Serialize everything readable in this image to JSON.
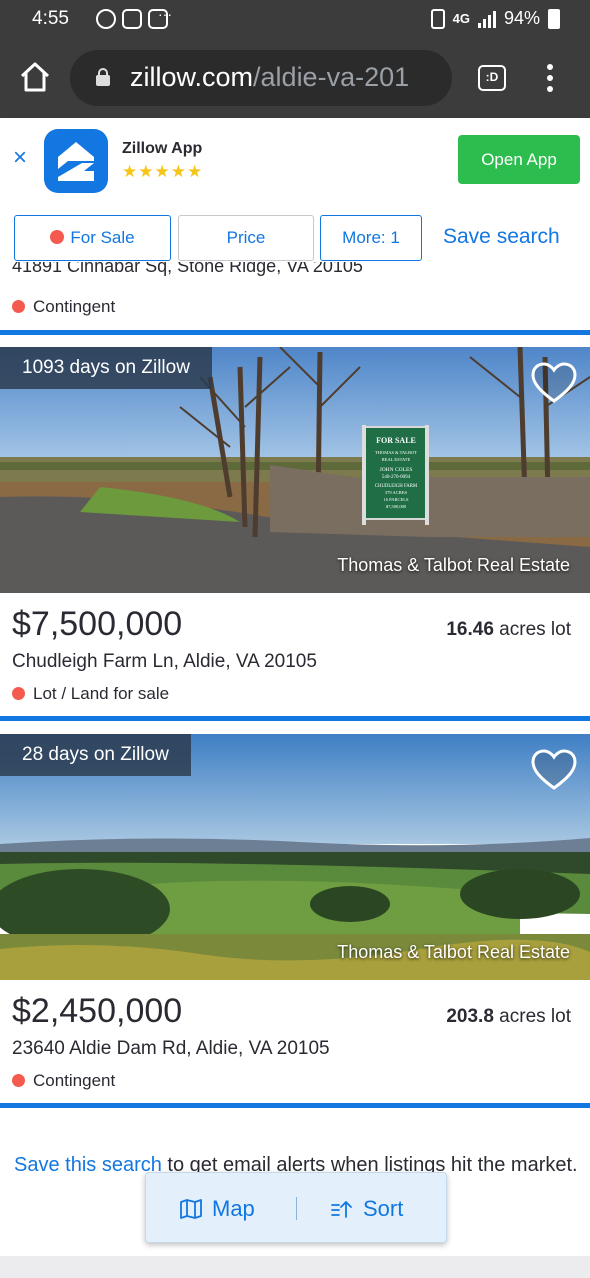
{
  "status_bar": {
    "time": "4:55",
    "dots": "···",
    "network": "4G",
    "battery": "94%"
  },
  "browser": {
    "url_host": "zillow.com",
    "url_path": "/aldie-va-201",
    "tabs_label": ":D"
  },
  "app_banner": {
    "close": "×",
    "app_name": "Zillow App",
    "stars": "★★★★★",
    "open_label": "Open App"
  },
  "filters": {
    "for_sale": "For Sale",
    "price": "Price",
    "more": "More: 1",
    "save_search": "Save search"
  },
  "partial_listing": {
    "address": "41891 Cinnabar Sq, Stone Ridge, VA 20105",
    "status": "Contingent"
  },
  "listings": [
    {
      "days": "1093 days on Zillow",
      "credit": "Thomas & Talbot Real Estate",
      "price": "$7,500,000",
      "lot_value": "16.46",
      "lot_unit": " acres lot",
      "address": "Chudleigh Farm Ln, Aldie, VA 20105",
      "status": "Lot / Land for sale",
      "sign": {
        "l1": "FOR SALE",
        "l2": "THOMAS & TALBOT",
        "l3": "REAL ESTATE",
        "l4": "JOHN COLES",
        "l5": "540-270-0094",
        "l6": "CHUDLEIGH FARM",
        "l7": "379 ACRES",
        "l8": "16 PARCELS",
        "l9": "$7,500,000"
      }
    },
    {
      "days": "28 days on Zillow",
      "credit": "Thomas & Talbot Real Estate",
      "price": "$2,450,000",
      "lot_value": "203.8",
      "lot_unit": " acres lot",
      "address": "23640 Aldie Dam Rd, Aldie, VA 20105",
      "status": "Contingent"
    }
  ],
  "footer": {
    "link": "Save this search",
    "text": " to get email alerts when listings hit the market."
  },
  "floating": {
    "map": "Map",
    "sort": "Sort"
  },
  "colors": {
    "brand_blue": "#1277e1",
    "open_app_green": "#2dbd4e",
    "status_red": "#f55a4e"
  }
}
